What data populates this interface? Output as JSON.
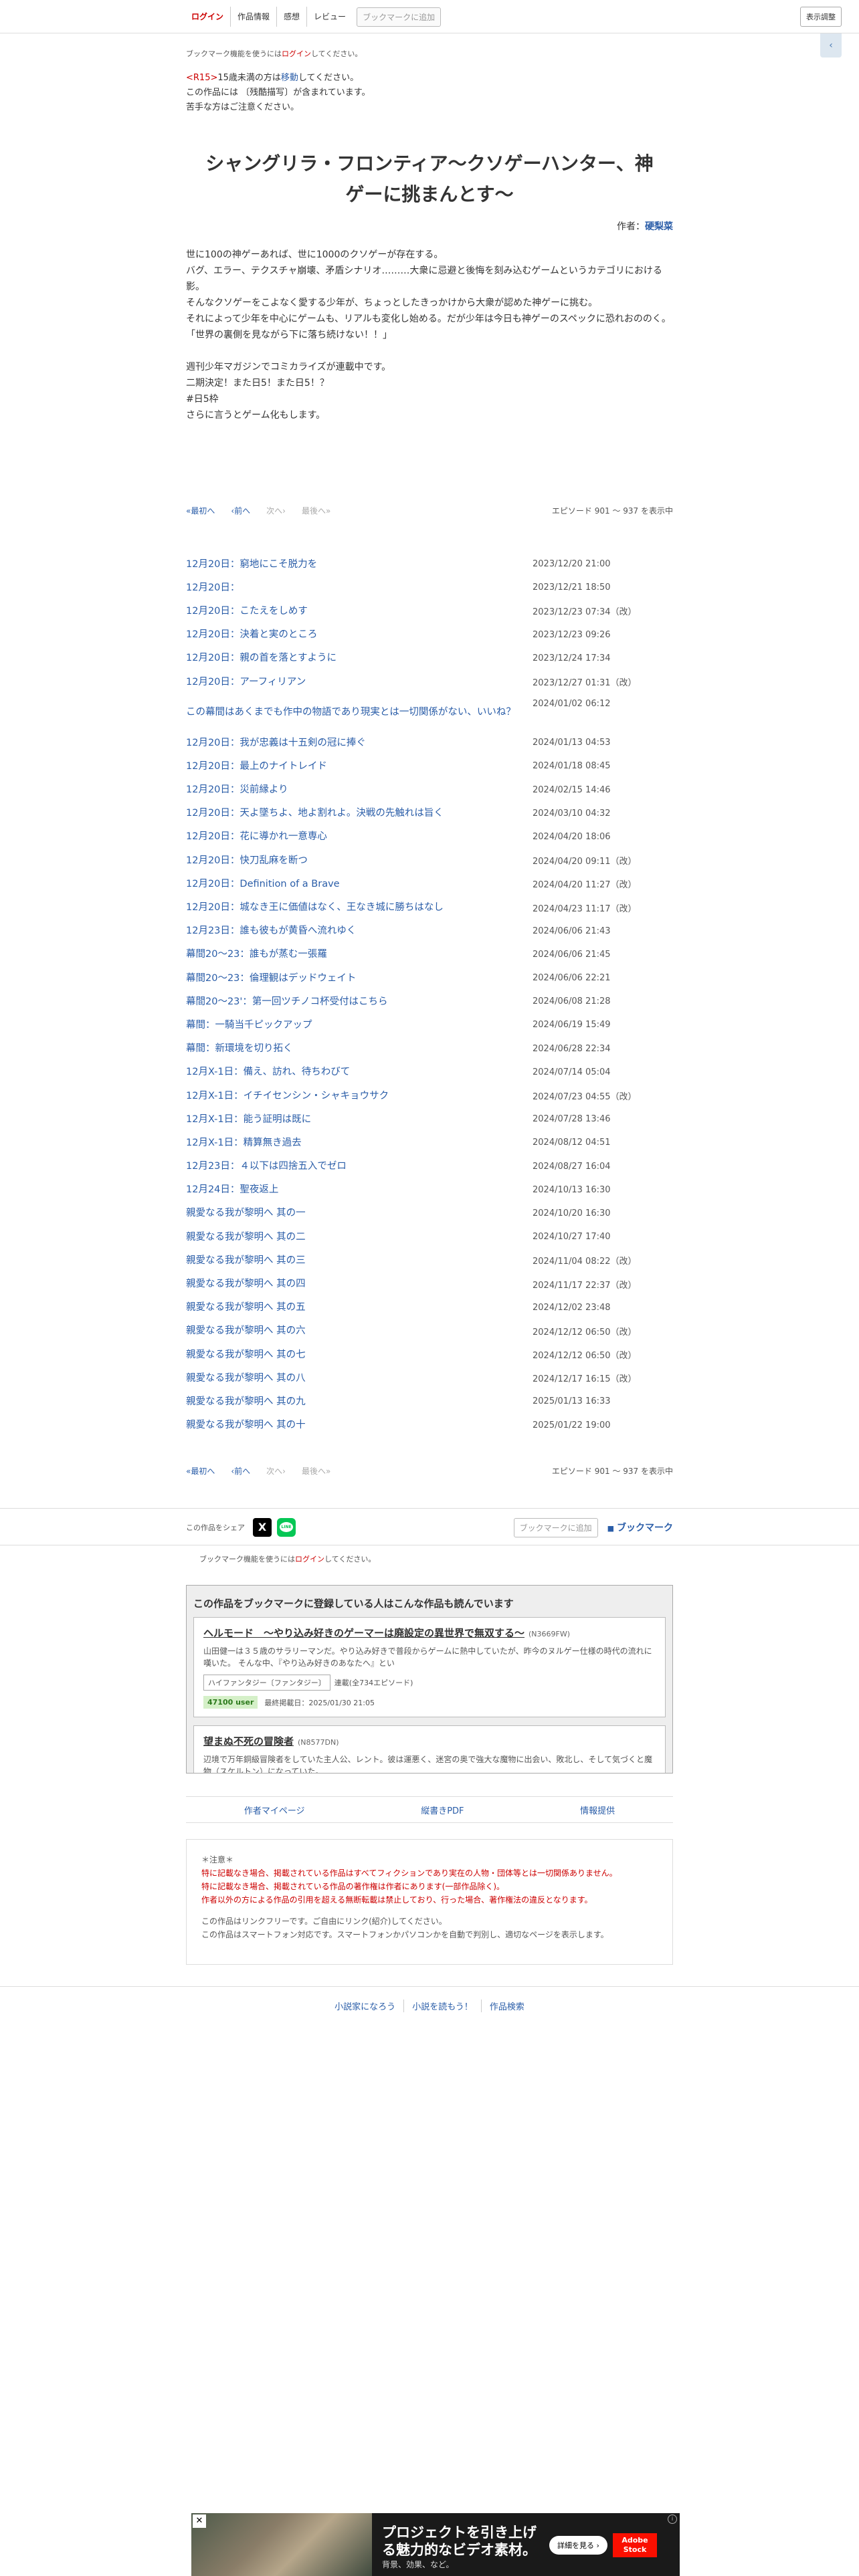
{
  "nav": {
    "login": "ログイン",
    "info": "作品情報",
    "impression": "感想",
    "review": "レビュー",
    "bookmark_add": "ブックマークに追加",
    "display_settings": "表示調整",
    "side_tab": "‹"
  },
  "notice": {
    "bookmark_prefix": "ブックマーク機能を使うには",
    "bookmark_login": "ログイン",
    "bookmark_suffix": "してください。"
  },
  "rating": {
    "tag": "<R15>",
    "line1_rest": "15歳未満の方は",
    "move": "移動",
    "line1_end": "してください。",
    "line2": "この作品には 〔残酷描写〕が含まれています。",
    "line3": "苦手な方はご注意ください。"
  },
  "novel": {
    "title": "シャングリラ・フロンティア〜クソゲーハンター、神ゲーに挑まんとす〜",
    "author_label": "作者：",
    "author_name": "硬梨菜",
    "synopsis": "世に100の神ゲーあれば、世に1000のクソゲーが存在する。\nバグ、エラー、テクスチャ崩壊、矛盾シナリオ………大衆に忌避と後悔を刻み込むゲームというカテゴリにおける影。\nそんなクソゲーをこよなく愛する少年が、ちょっとしたきっかけから大衆が認めた神ゲーに挑む。\nそれによって少年を中心にゲームも、リアルも変化し始める。だが少年は今日も神ゲーのスペックに恐れおののく。\n「世界の裏側を見ながら下に落ち続けない！！」\n\n週刊少年マガジンでコミカライズが連載中です。\n二期決定！また日5！また日5！？\n#日5枠\nさらに言うとゲーム化もします。"
  },
  "pager": {
    "first": "«最初へ",
    "prev": "‹前へ",
    "next": "次へ›",
    "last": "最後へ»",
    "count": "エピソード 901 〜 937 を表示中"
  },
  "episodes": [
    {
      "title": "12月20日：窮地にこそ脱力を",
      "date": "2023/12/20 21:00"
    },
    {
      "title": "12月20日：",
      "date": "2023/12/21 18:50"
    },
    {
      "title": "12月20日：こたえをしめす",
      "date": "2023/12/23 07:34（改）"
    },
    {
      "title": "12月20日：決着と実のところ",
      "date": "2023/12/23 09:26"
    },
    {
      "title": "12月20日：親の首を落とすように",
      "date": "2023/12/24 17:34"
    },
    {
      "title": "12月20日：アーフィリアン",
      "date": "2023/12/27 01:31（改）"
    },
    {
      "title": "この幕間はあくまでも作中の物語であり現実とは一切関係がない、いいね？",
      "date": "2024/01/02 06:12",
      "tall": true
    },
    {
      "title": "12月20日：我が忠義は十五剣の冠に捧ぐ",
      "date": "2024/01/13 04:53"
    },
    {
      "title": "12月20日：最上のナイトレイド",
      "date": "2024/01/18 08:45"
    },
    {
      "title": "12月20日：災前縁より",
      "date": "2024/02/15 14:46"
    },
    {
      "title": "12月20日：天よ墜ちよ、地よ割れよ。決戦の先触れは旨く",
      "date": "2024/03/10 04:32"
    },
    {
      "title": "12月20日：花に導かれ一意専心",
      "date": "2024/04/20 18:06"
    },
    {
      "title": "12月20日：快刀乱麻を断つ",
      "date": "2024/04/20 09:11（改）"
    },
    {
      "title": "12月20日：Definition of a Brave",
      "date": "2024/04/20 11:27（改）"
    },
    {
      "title": "12月20日：城なき王に価値はなく、王なき城に勝ちはなし",
      "date": "2024/04/23 11:17（改）"
    },
    {
      "title": "12月23日：誰も彼もが黄昏へ流れゆく",
      "date": "2024/06/06 21:43"
    },
    {
      "title": "幕間20〜23：誰もが蒸む一張羅",
      "date": "2024/06/06 21:45"
    },
    {
      "title": "幕間20〜23：倫理観はデッドウェイト",
      "date": "2024/06/06 22:21"
    },
    {
      "title": "幕間20〜23'：第一回ツチノコ杯受付はこちら",
      "date": "2024/06/08 21:28"
    },
    {
      "title": "幕間：一騎当千ピックアップ",
      "date": "2024/06/19 15:49"
    },
    {
      "title": "幕間：新環境を切り拓く",
      "date": "2024/06/28 22:34"
    },
    {
      "title": "12月X-1日：備え、訪れ、待ちわびて",
      "date": "2024/07/14 05:04"
    },
    {
      "title": "12月X-1日：イチイセンシン・シャキョウサク",
      "date": "2024/07/23 04:55（改）"
    },
    {
      "title": "12月X-1日：能う証明は既に",
      "date": "2024/07/28 13:46"
    },
    {
      "title": "12月X-1日：精算無き過去",
      "date": "2024/08/12 04:51"
    },
    {
      "title": "12月23日：４以下は四捨五入でゼロ",
      "date": "2024/08/27 16:04"
    },
    {
      "title": "12月24日：聖夜返上",
      "date": "2024/10/13 16:30"
    },
    {
      "title": "親愛なる我が黎明へ 其の一",
      "date": "2024/10/20 16:30"
    },
    {
      "title": "親愛なる我が黎明へ 其の二",
      "date": "2024/10/27 17:40"
    },
    {
      "title": "親愛なる我が黎明へ 其の三",
      "date": "2024/11/04 08:22（改）"
    },
    {
      "title": "親愛なる我が黎明へ 其の四",
      "date": "2024/11/17 22:37（改）"
    },
    {
      "title": "親愛なる我が黎明へ 其の五",
      "date": "2024/12/02 23:48"
    },
    {
      "title": "親愛なる我が黎明へ 其の六",
      "date": "2024/12/12 06:50（改）"
    },
    {
      "title": "親愛なる我が黎明へ 其の七",
      "date": "2024/12/12 06:50（改）"
    },
    {
      "title": "親愛なる我が黎明へ 其の八",
      "date": "2024/12/17 16:15（改）"
    },
    {
      "title": "親愛なる我が黎明へ 其の九",
      "date": "2025/01/13 16:33"
    },
    {
      "title": "親愛なる我が黎明へ 其の十",
      "date": "2025/01/22 19:00"
    }
  ],
  "share": {
    "label": "この作品をシェア",
    "x": "X",
    "line": "LINE",
    "bookmark_add": "ブックマークに追加",
    "bookmark": "ブックマーク"
  },
  "reco": {
    "heading": "この作品をブックマークに登録している人はこんな作品も読んでいます",
    "cards": [
      {
        "title": "ヘルモード　〜やり込み好きのゲーマーは廃設定の異世界で無双する〜",
        "ncode": "(N3669FW)",
        "desc": "山田健一は３５歳のサラリーマンだ。やり込み好きで普段からゲームに熱中していたが、昨今のヌルゲー仕様の時代の流れに嘆いた。 そんな中、『やり込み好きのあなたへ』とい",
        "genre": "ハイファンタジー〔ファンタジー〕",
        "status": "連載(全734エピソード)",
        "users": "47100 user",
        "updated": "最終掲載日：2025/01/30 21:05"
      },
      {
        "title": "望まぬ不死の冒険者",
        "ncode": "(N8577DN)",
        "desc": "辺境で万年銅級冒険者をしていた主人公、レント。彼は運悪く、迷宮の奥で強大な魔物に出会い、敗北し、そして気づくと魔物（スケルトン）になっていた。",
        "genre": "",
        "status": "",
        "users": "",
        "updated": ""
      }
    ]
  },
  "links": {
    "author_page": "作者マイページ",
    "pdf": "縦書きPDF",
    "info": "情報提供"
  },
  "caution": {
    "head": "＊注意＊",
    "red1": "特に記載なき場合、掲載されている作品はすべてフィクションであり実在の人物・団体等とは一切関係ありません。",
    "red2": "特に記載なき場合、掲載されている作品の著作権は作者にあります(一部作品除く)。",
    "red3": "作者以外の方による作品の引用を超える無断転載は禁止しており、行った場合、著作権法の違反となります。",
    "gray1": "この作品はリンクフリーです。ご自由にリンク(紹介)してください。",
    "gray2": "この作品はスマートフォン対応です。スマートフォンかパソコンかを自動で判別し、適切なページを表示します。"
  },
  "footer": {
    "link1": "小説家になろう",
    "link2": "小説を読もう！",
    "link3": "作品検索"
  },
  "ad": {
    "headline": "プロジェクトを引き上げる魅力的なビデオ素材。",
    "sub": "背景、効果、など。",
    "cta": "詳細を見る ›",
    "brand": "Adobe Stock",
    "close": "✕",
    "info": "i"
  }
}
